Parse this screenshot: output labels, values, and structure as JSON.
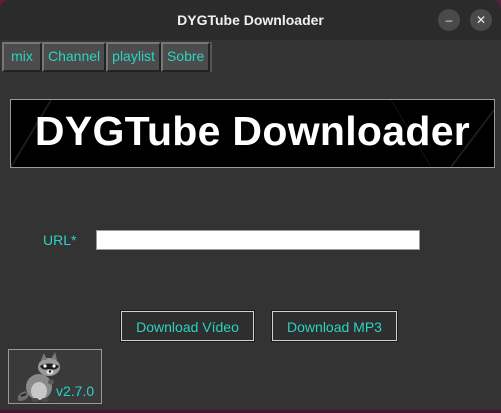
{
  "window": {
    "title": "DYGTube Downloader",
    "minimize_glyph": "–",
    "close_glyph": "✕"
  },
  "tabs": [
    {
      "label": "mix"
    },
    {
      "label": "Channel"
    },
    {
      "label": "playlist"
    },
    {
      "label": "Sobre"
    }
  ],
  "banner": {
    "text": "DYGTube Downloader"
  },
  "form": {
    "url_label": "URL*",
    "url_value": ""
  },
  "buttons": {
    "download_video": "Download Vídeo",
    "download_mp3": "Download MP3"
  },
  "footer": {
    "version": "v2.7.0",
    "mascot_icon": "raccoon-icon"
  },
  "colors": {
    "accent": "#2bd3c2",
    "window_bg": "#333333",
    "titlebar_bg": "#2b2b2b",
    "banner_bg": "#000000"
  }
}
